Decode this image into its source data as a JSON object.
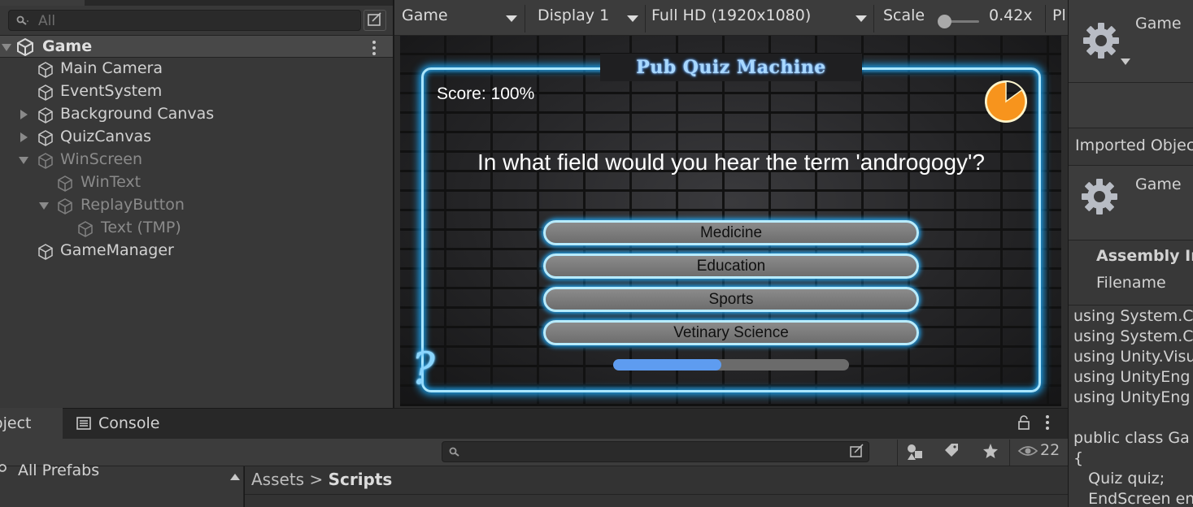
{
  "hierarchy": {
    "search_placeholder": "All",
    "scene": "Game",
    "items": [
      {
        "label": "Main Camera"
      },
      {
        "label": "EventSystem"
      },
      {
        "label": "Background Canvas"
      },
      {
        "label": "QuizCanvas"
      },
      {
        "label": "WinScreen"
      },
      {
        "label": "WinText"
      },
      {
        "label": "ReplayButton"
      },
      {
        "label": "Text (TMP)"
      },
      {
        "label": "GameManager"
      }
    ]
  },
  "game_toolbar": {
    "view": "Game",
    "display": "Display 1",
    "resolution": "Full HD (1920x1080)",
    "scale_label": "Scale",
    "scale_value": "0.42x",
    "play_truncated": "Pl"
  },
  "quiz": {
    "title": "Pub Quiz Machine",
    "score": "Score: 100%",
    "question": "In what field would you hear the term 'androgogy'?",
    "answers": [
      "Medicine",
      "Education",
      "Sports",
      "Vetinary Science"
    ],
    "progress_fraction": 0.46,
    "timer_remaining_fraction": 0.85,
    "question_mark": "?",
    "colors": {
      "neon": "#1ba3f0",
      "timer": "#f7941d",
      "progress": "#5e9cf0"
    }
  },
  "inspector": {
    "top_title": "Game",
    "imported": "Imported Objec",
    "second_title": "Game",
    "assembly": "Assembly In",
    "filename": "Filename",
    "code": [
      "using System.C",
      "using System.C",
      "using Unity.Visu",
      "using UnityEng",
      "using UnityEng",
      "",
      "public class Ga",
      "{",
      "   Quiz quiz;",
      "   EndScreen en"
    ]
  },
  "project": {
    "tab_project": "oject",
    "tab_console": "Console",
    "left_item": "All Prefabs",
    "breadcrumb_root": "Assets",
    "breadcrumb_sep": ">",
    "breadcrumb_current": "Scripts",
    "visible_count": "22"
  }
}
